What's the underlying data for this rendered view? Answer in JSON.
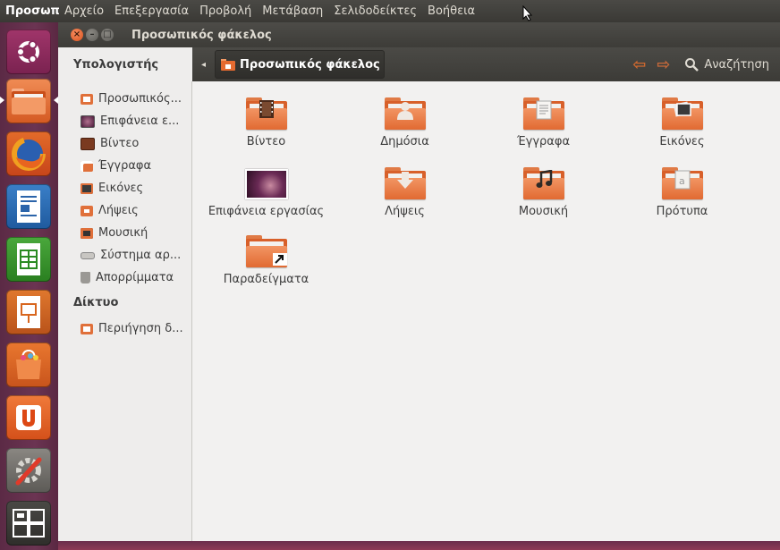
{
  "topbar": {
    "app_title": "Προσωπ",
    "menu": [
      "Αρχείο",
      "Επεξεργασία",
      "Προβολή",
      "Μετάβαση",
      "Σελιδοδείκτες",
      "Βοήθεια"
    ]
  },
  "launcher": {
    "icons": [
      "ubuntu-logo-icon",
      "home-folder-icon",
      "firefox-icon",
      "writer-icon",
      "calc-icon",
      "impress-icon",
      "software-center-icon",
      "ubuntu-one-icon",
      "system-settings-icon",
      "workspace-switcher-icon"
    ]
  },
  "window": {
    "title": "Προσωπικός φάκελος",
    "path_button": "Προσωπικός φάκελος",
    "search_label": "Αναζήτηση"
  },
  "sidebar": {
    "computer_heading": "Υπολογιστής",
    "computer_items": [
      {
        "label": "Προσωπικός...",
        "icon": "home-icon"
      },
      {
        "label": "Επιφάνεια ε...",
        "icon": "desktop-icon"
      },
      {
        "label": "Βίντεο",
        "icon": "video-icon"
      },
      {
        "label": "Έγγραφα",
        "icon": "documents-icon"
      },
      {
        "label": "Εικόνες",
        "icon": "pictures-icon"
      },
      {
        "label": "Λήψεις",
        "icon": "downloads-icon"
      },
      {
        "label": "Μουσική",
        "icon": "music-icon"
      },
      {
        "label": "Σύστημα αρ...",
        "icon": "drive-icon"
      },
      {
        "label": "Απορρίμματα",
        "icon": "trash-icon"
      }
    ],
    "network_heading": "Δίκτυο",
    "network_items": [
      {
        "label": "Περιήγηση δ...",
        "icon": "network-icon"
      }
    ]
  },
  "files": [
    {
      "label": "Βίντεο",
      "icon": "video-folder-icon"
    },
    {
      "label": "Δημόσια",
      "icon": "public-folder-icon"
    },
    {
      "label": "Έγγραφα",
      "icon": "documents-folder-icon"
    },
    {
      "label": "Εικόνες",
      "icon": "pictures-folder-icon"
    },
    {
      "label": "Επιφάνεια εργασίας",
      "icon": "desktop-thumbnail-icon"
    },
    {
      "label": "Λήψεις",
      "icon": "downloads-folder-icon"
    },
    {
      "label": "Μουσική",
      "icon": "music-folder-icon"
    },
    {
      "label": "Πρότυπα",
      "icon": "templates-folder-icon"
    },
    {
      "label": "Παραδείγματα",
      "icon": "examples-folder-icon"
    }
  ],
  "colors": {
    "accent": "#dd4814",
    "launcher_bg": "#6b3452",
    "panel_bg": "#3c3b37"
  }
}
